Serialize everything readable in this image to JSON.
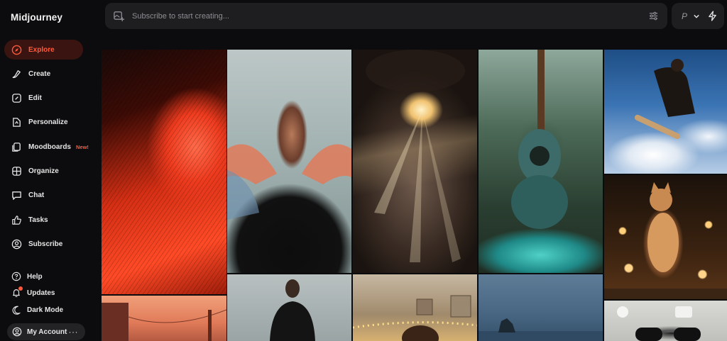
{
  "app": {
    "brand": "Midjourney"
  },
  "sidebar": {
    "nav": [
      {
        "label": "Explore",
        "icon": "compass-icon",
        "active": true
      },
      {
        "label": "Create",
        "icon": "brush-icon"
      },
      {
        "label": "Edit",
        "icon": "edit-icon"
      },
      {
        "label": "Personalize",
        "icon": "personalize-icon"
      },
      {
        "label": "Moodboards",
        "icon": "moodboard-icon",
        "badge": "New!"
      },
      {
        "label": "Organize",
        "icon": "grid-icon"
      },
      {
        "label": "Chat",
        "icon": "chat-icon"
      },
      {
        "label": "Tasks",
        "icon": "thumbs-up-icon"
      },
      {
        "label": "Subscribe",
        "icon": "user-circle-icon"
      }
    ],
    "bottom": [
      {
        "label": "Help",
        "icon": "help-icon"
      },
      {
        "label": "Updates",
        "icon": "bell-icon"
      },
      {
        "label": "Dark Mode",
        "icon": "moon-icon"
      }
    ],
    "account": {
      "label": "My Account",
      "more": "···",
      "icon": "user-circle-icon"
    }
  },
  "topbar": {
    "prompt_placeholder": "Subscribe to start creating...",
    "mode_letter": "P"
  },
  "colors": {
    "accent": "#ff5a3c",
    "active_bg": "#3a1410",
    "panel": "#1e1e21",
    "bg": "#0c0c0e"
  }
}
